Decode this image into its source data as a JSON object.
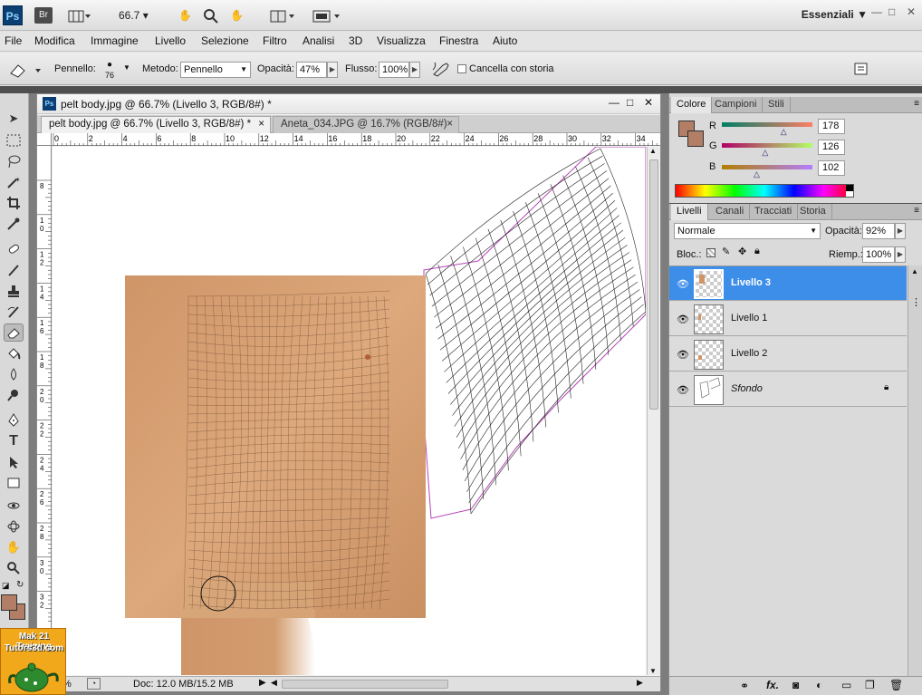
{
  "app_bar": {
    "ps_logo": "Ps",
    "br_logo": "Br",
    "zoom": "66.7",
    "workspace": "Essenziali"
  },
  "menu": [
    "File",
    "Modifica",
    "Immagine",
    "Livello",
    "Selezione",
    "Filtro",
    "Analisi",
    "3D",
    "Visualizza",
    "Finestra",
    "Aiuto"
  ],
  "options": {
    "brush_label": "Pennello:",
    "brush_size": "76",
    "method_label": "Metodo:",
    "method_value": "Pennello",
    "opacity_label": "Opacità:",
    "opacity_value": "47%",
    "flow_label": "Flusso:",
    "flow_value": "100%",
    "erase_history_label": "Cancella con storia"
  },
  "document": {
    "window_title": "pelt body.jpg @ 66.7% (Livello 3, RGB/8#) *",
    "tabs": [
      {
        "label": "pelt body.jpg @ 66.7% (Livello 3, RGB/8#) *",
        "close": "×"
      },
      {
        "label": "Aneta_034.JPG @ 16.7% (RGB/8#)",
        "close": "×"
      }
    ],
    "ruler_h": [
      "0",
      "2",
      "4",
      "6",
      "8",
      "10",
      "12",
      "14",
      "16",
      "18",
      "20",
      "22",
      "24",
      "26",
      "28",
      "30",
      "32",
      "34"
    ],
    "ruler_v": [
      "8",
      "1 0",
      "1 2",
      "1 4",
      "1 6",
      "1 8",
      "2 0",
      "2 2",
      "2 4",
      "2 6",
      "2 8",
      "3 0",
      "3 2"
    ],
    "status_zoom": "%",
    "status_doc": "Doc: 12.0 MB/15.2 MB"
  },
  "color_panel": {
    "tabs": [
      "Colore",
      "Campioni",
      "Stili"
    ],
    "r_label": "R",
    "r_value": "178",
    "r_level": 0.698,
    "g_label": "G",
    "g_value": "126",
    "g_level": 0.494,
    "b_label": "B",
    "b_value": "102",
    "b_level": 0.4,
    "fg_color": "#b27e66"
  },
  "layers_panel": {
    "tabs": [
      "Livelli",
      "Canali",
      "Tracciati",
      "Storia"
    ],
    "blend_mode": "Normale",
    "opacity_label": "Opacità:",
    "opacity_value": "92%",
    "lock_label": "Bloc.:",
    "fill_label": "Riemp.:",
    "fill_value": "100%",
    "layers": [
      {
        "name": "Livello 3",
        "selected": true
      },
      {
        "name": "Livello 1",
        "selected": false
      },
      {
        "name": "Livello 2",
        "selected": false
      },
      {
        "name": "Sfondo",
        "selected": false
      }
    ]
  },
  "watermark": {
    "line1": "Mak 21 Training",
    "line2": "Tutors3d.com"
  },
  "colors": {
    "skin": "#cf9a6c",
    "selection_blue": "#3d8ee8",
    "ps_blue": "#0b3f74"
  }
}
